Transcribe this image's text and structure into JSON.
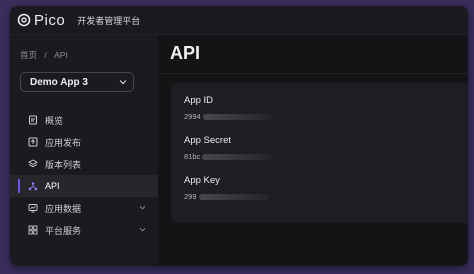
{
  "brand": {
    "logo_text": "Pico",
    "portal_title": "开发者管理平台"
  },
  "breadcrumb": {
    "home": "首页",
    "separator": "/",
    "current": "API"
  },
  "app_selector": {
    "selected": "Demo App 3"
  },
  "nav": {
    "overview": "概览",
    "publish": "应用发布",
    "versions": "版本列表",
    "api": "API",
    "data": "应用数据",
    "services": "平台服务"
  },
  "page": {
    "title": "API"
  },
  "credentials": {
    "app_id_label": "App ID",
    "app_id_visible": "2994",
    "app_secret_label": "App Secret",
    "app_secret_visible": "81bc",
    "app_key_label": "App Key",
    "app_key_visible": "299"
  },
  "colors": {
    "accent": "#6f55ff",
    "background": "#141417",
    "sidebar": "#1b1b1f",
    "card": "#1d1d22"
  }
}
